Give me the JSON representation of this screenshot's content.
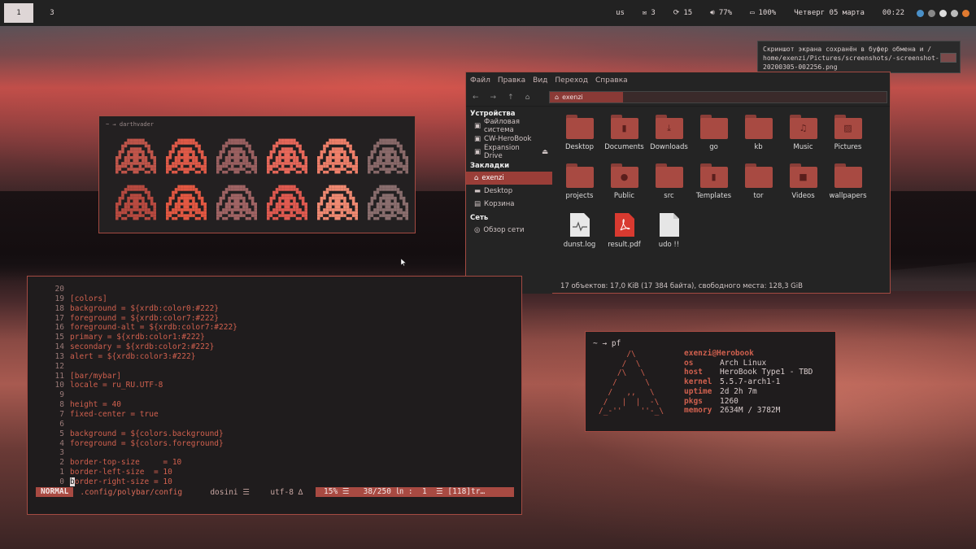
{
  "bar": {
    "workspaces": [
      {
        "label": "1",
        "active": true
      },
      {
        "label": "3",
        "active": false
      }
    ],
    "layout": "us",
    "mail_count": "3",
    "updates_count": "15",
    "volume": "77%",
    "battery": "100%",
    "date": "Четверг 05 марта",
    "time": "00:22"
  },
  "notification": {
    "text": "Скриншот экрана сохранён в буфер обмена и / home/exenzi/Pictures/screenshots/-screenshot-20200305-002256.png"
  },
  "darthvader": {
    "title": "~ → darthvader",
    "colors": [
      "#c0554a",
      "#e05a48",
      "#9a6060",
      "#e8685a",
      "#f0806a",
      "#8a6a6a",
      "#b84a40",
      "#e35842",
      "#a06464",
      "#e05a50",
      "#f08a72",
      "#8a6e6e"
    ]
  },
  "file_manager": {
    "menu": [
      "Файл",
      "Правка",
      "Вид",
      "Переход",
      "Справка"
    ],
    "path_segment": "exenzi",
    "sidebar": {
      "devices_header": "Устройства",
      "devices": [
        "Файловая система",
        "CW-HeroBook",
        "Expansion Drive"
      ],
      "bookmarks_header": "Закладки",
      "bookmarks": [
        "exenzi",
        "Desktop",
        "Корзина"
      ],
      "network_header": "Сеть",
      "network": [
        "Обзор сети"
      ]
    },
    "items": [
      {
        "name": "Desktop",
        "kind": "folder-plain"
      },
      {
        "name": "Documents",
        "kind": "folder-doc"
      },
      {
        "name": "Downloads",
        "kind": "folder-down"
      },
      {
        "name": "go",
        "kind": "folder"
      },
      {
        "name": "kb",
        "kind": "folder"
      },
      {
        "name": "Music",
        "kind": "folder-music"
      },
      {
        "name": "Pictures",
        "kind": "folder-pic"
      },
      {
        "name": "projects",
        "kind": "folder"
      },
      {
        "name": "Public",
        "kind": "folder-user"
      },
      {
        "name": "src",
        "kind": "folder"
      },
      {
        "name": "Templates",
        "kind": "folder-doc"
      },
      {
        "name": "tor",
        "kind": "folder"
      },
      {
        "name": "Videos",
        "kind": "folder-video"
      },
      {
        "name": "wallpapers",
        "kind": "folder"
      },
      {
        "name": "dunst.log",
        "kind": "log"
      },
      {
        "name": "result.pdf",
        "kind": "pdf"
      },
      {
        "name": "udo !!",
        "kind": "file"
      }
    ],
    "status": "17 объектов: 17,0 KiB (17 384 байта), свободного места: 128,3 GiB"
  },
  "vim": {
    "lines": [
      {
        "n": "20",
        "t": ""
      },
      {
        "n": "19",
        "t": "[colors]"
      },
      {
        "n": "18",
        "t": "background = ${xrdb:color0:#222}"
      },
      {
        "n": "17",
        "t": "foreground = ${xrdb:color7:#222}"
      },
      {
        "n": "16",
        "t": "foreground-alt = ${xrdb:color7:#222}"
      },
      {
        "n": "15",
        "t": "primary = ${xrdb:color1:#222}"
      },
      {
        "n": "14",
        "t": "secondary = ${xrdb:color2:#222}"
      },
      {
        "n": "13",
        "t": "alert = ${xrdb:color3:#222}"
      },
      {
        "n": "12",
        "t": ""
      },
      {
        "n": "11",
        "t": "[bar/mybar]"
      },
      {
        "n": "10",
        "t": "locale = ru_RU.UTF-8"
      },
      {
        "n": "9",
        "t": ""
      },
      {
        "n": "8",
        "t": "height = 40"
      },
      {
        "n": "7",
        "t": "fixed-center = true"
      },
      {
        "n": "6",
        "t": ""
      },
      {
        "n": "5",
        "t": "background = ${colors.background}"
      },
      {
        "n": "4",
        "t": "foreground = ${colors.foreground}"
      },
      {
        "n": "3",
        "t": ""
      },
      {
        "n": "2",
        "t": "border-top-size     = 10"
      },
      {
        "n": "1",
        "t": "border-left-size  = 10"
      },
      {
        "n": "0",
        "t": "border-right-size = 10"
      }
    ],
    "status": {
      "mode": "NORMAL",
      "file": ".config/polybar/config",
      "filetype": "dosini ☰",
      "encoding": "utf-8 ∆",
      "position": " 15% ☰   38/250 ㏑ :  1  ☰ [118]tr…"
    }
  },
  "pf": {
    "prompt": "~ → pf",
    "user": "exenzi@Herobook",
    "rows": [
      {
        "k": "os",
        "v": "Arch Linux"
      },
      {
        "k": "host",
        "v": "HeroBook Type1 - TBD"
      },
      {
        "k": "kernel",
        "v": "5.5.7-arch1-1"
      },
      {
        "k": "uptime",
        "v": "2d 2h 7m"
      },
      {
        "k": "pkgs",
        "v": "1260"
      },
      {
        "k": "memory",
        "v": "2634M / 3782M"
      }
    ]
  }
}
